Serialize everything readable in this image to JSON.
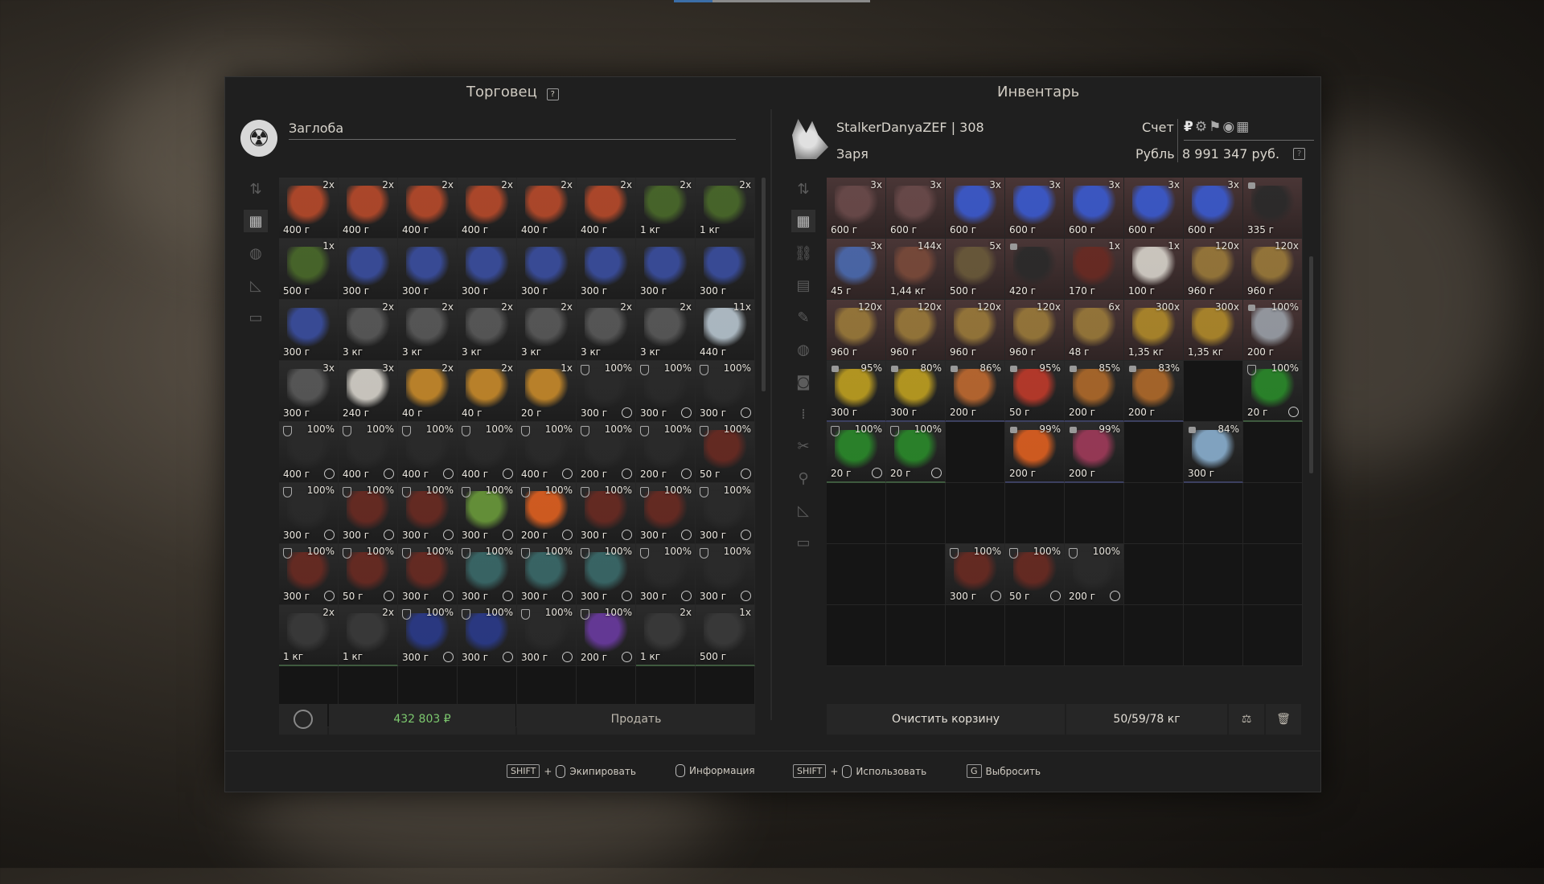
{
  "trader": {
    "title": "Торговец",
    "help": "?",
    "name": "Заглоба",
    "money": "432 803 ₽",
    "sell_label": "Продать",
    "sidebar_icons": [
      "sort-icon",
      "grid-icon",
      "grenade-icon",
      "ruler-icon",
      "box-icon"
    ],
    "slots": [
      {
        "c": "2x",
        "w": "400 г",
        "k": "cube"
      },
      {
        "c": "2x",
        "w": "400 г",
        "k": "cube"
      },
      {
        "c": "2x",
        "w": "400 г",
        "k": "cube"
      },
      {
        "c": "2x",
        "w": "400 г",
        "k": "cube"
      },
      {
        "c": "2x",
        "w": "400 г",
        "k": "cube"
      },
      {
        "c": "2x",
        "w": "400 г",
        "k": "cube"
      },
      {
        "c": "2x",
        "w": "1 кг",
        "k": "green"
      },
      {
        "c": "2x",
        "w": "1 кг",
        "k": "green"
      },
      {
        "c": "1x",
        "w": "500 г",
        "k": "green"
      },
      {
        "c": "",
        "w": "300 г",
        "k": "blue"
      },
      {
        "c": "",
        "w": "300 г",
        "k": "blue"
      },
      {
        "c": "",
        "w": "300 г",
        "k": "blue"
      },
      {
        "c": "",
        "w": "300 г",
        "k": "blue"
      },
      {
        "c": "",
        "w": "300 г",
        "k": "blue"
      },
      {
        "c": "",
        "w": "300 г",
        "k": "blue"
      },
      {
        "c": "",
        "w": "300 г",
        "k": "blue"
      },
      {
        "c": "",
        "w": "300 г",
        "k": "blue"
      },
      {
        "c": "2x",
        "w": "3 кг",
        "k": "gray"
      },
      {
        "c": "2x",
        "w": "3 кг",
        "k": "gray"
      },
      {
        "c": "2x",
        "w": "3 кг",
        "k": "gray"
      },
      {
        "c": "2x",
        "w": "3 кг",
        "k": "gray"
      },
      {
        "c": "2x",
        "w": "3 кг",
        "k": "gray"
      },
      {
        "c": "2x",
        "w": "3 кг",
        "k": "gray"
      },
      {
        "c": "11x",
        "w": "440 г",
        "k": "paper"
      },
      {
        "c": "3x",
        "w": "300 г",
        "k": "gray"
      },
      {
        "c": "3x",
        "w": "240 г",
        "k": "white"
      },
      {
        "c": "2x",
        "w": "40 г",
        "k": "orange"
      },
      {
        "c": "2x",
        "w": "40 г",
        "k": "orange"
      },
      {
        "c": "1x",
        "w": "20 г",
        "k": "orange"
      },
      {
        "c": "100%",
        "w": "300 г",
        "k": "dark",
        "a": 1
      },
      {
        "c": "100%",
        "w": "300 г",
        "k": "dark",
        "a": 1
      },
      {
        "c": "100%",
        "w": "300 г",
        "k": "dark",
        "a": 1
      },
      {
        "c": "100%",
        "w": "400 г",
        "k": "dark",
        "a": 1
      },
      {
        "c": "100%",
        "w": "400 г",
        "k": "dark",
        "a": 1
      },
      {
        "c": "100%",
        "w": "400 г",
        "k": "dark",
        "a": 1
      },
      {
        "c": "100%",
        "w": "400 г",
        "k": "dark",
        "a": 1
      },
      {
        "c": "100%",
        "w": "400 г",
        "k": "dark",
        "a": 1
      },
      {
        "c": "100%",
        "w": "200 г",
        "k": "dark",
        "a": 1
      },
      {
        "c": "100%",
        "w": "200 г",
        "k": "dark",
        "a": 1
      },
      {
        "c": "100%",
        "w": "50 г",
        "k": "rust",
        "a": 1
      },
      {
        "c": "100%",
        "w": "300 г",
        "k": "dark",
        "a": 1
      },
      {
        "c": "100%",
        "w": "300 г",
        "k": "rust",
        "a": 1
      },
      {
        "c": "100%",
        "w": "300 г",
        "k": "rust",
        "a": 1
      },
      {
        "c": "100%",
        "w": "300 г",
        "k": "lime",
        "a": 1
      },
      {
        "c": "100%",
        "w": "200 г",
        "k": "fire",
        "a": 1
      },
      {
        "c": "100%",
        "w": "300 г",
        "k": "rust",
        "a": 1
      },
      {
        "c": "100%",
        "w": "300 г",
        "k": "rust",
        "a": 1
      },
      {
        "c": "100%",
        "w": "300 г",
        "k": "dark",
        "a": 1
      },
      {
        "c": "100%",
        "w": "300 г",
        "k": "rust",
        "a": 1
      },
      {
        "c": "100%",
        "w": "50 г",
        "k": "rust",
        "a": 1
      },
      {
        "c": "100%",
        "w": "300 г",
        "k": "rust",
        "a": 1
      },
      {
        "c": "100%",
        "w": "300 г",
        "k": "teal",
        "a": 1
      },
      {
        "c": "100%",
        "w": "300 г",
        "k": "teal",
        "a": 1
      },
      {
        "c": "100%",
        "w": "300 г",
        "k": "teal",
        "a": 1
      },
      {
        "c": "100%",
        "w": "300 г",
        "k": "dark",
        "a": 1
      },
      {
        "c": "100%",
        "w": "300 г",
        "k": "dark",
        "a": 1
      },
      {
        "c": "2x",
        "w": "1 кг",
        "k": "knife",
        "g": 1
      },
      {
        "c": "2x",
        "w": "1 кг",
        "k": "knife",
        "g": 1
      },
      {
        "c": "100%",
        "w": "300 г",
        "k": "navy",
        "a": 1
      },
      {
        "c": "100%",
        "w": "300 г",
        "k": "navy",
        "a": 1
      },
      {
        "c": "100%",
        "w": "300 г",
        "k": "dark",
        "a": 1
      },
      {
        "c": "100%",
        "w": "200 г",
        "k": "spark",
        "a": 1
      },
      {
        "c": "2x",
        "w": "1 кг",
        "k": "knife",
        "g": 1
      },
      {
        "c": "1x",
        "w": "500 г",
        "k": "knife",
        "g": 1
      },
      {
        "e": 1
      },
      {
        "e": 1
      },
      {
        "e": 1
      },
      {
        "e": 1
      },
      {
        "e": 1
      },
      {
        "e": 1
      },
      {
        "e": 1
      },
      {
        "e": 1
      }
    ]
  },
  "inventory": {
    "title": "Инвентарь",
    "player": "StalkerDanyaZEF | 308",
    "faction": "Заря",
    "account_label": "Счет",
    "currency_label": "Рубль",
    "balance": "8 991 347 руб.",
    "clear_label": "Очистить корзину",
    "weight": "50/59/78 кг",
    "sidebar_icons": [
      "sort-icon",
      "grid-icon",
      "link-icon",
      "armor-icon",
      "knife-icon",
      "grenade-icon",
      "camera-icon",
      "bullets-icon",
      "tools-icon",
      "food-icon",
      "ruler-icon",
      "box-icon"
    ],
    "slots": [
      {
        "c": "3x",
        "w": "600 г",
        "k": "can",
        "r": 1
      },
      {
        "c": "3x",
        "w": "600 г",
        "k": "can",
        "r": 1
      },
      {
        "c": "3x",
        "w": "600 г",
        "k": "bluecan",
        "r": 1
      },
      {
        "c": "3x",
        "w": "600 г",
        "k": "bluecan",
        "r": 1
      },
      {
        "c": "3x",
        "w": "600 г",
        "k": "bluecan",
        "r": 1
      },
      {
        "c": "3x",
        "w": "600 г",
        "k": "bluecan",
        "r": 1
      },
      {
        "c": "3x",
        "w": "600 г",
        "k": "bluecan",
        "r": 1
      },
      {
        "c": "",
        "w": "335 г",
        "k": "dark",
        "r": 1,
        "l": 1
      },
      {
        "c": "3x",
        "w": "45 г",
        "k": "feather",
        "r": 1
      },
      {
        "c": "144x",
        "w": "1,44 кг",
        "k": "rod",
        "r": 1
      },
      {
        "c": "5x",
        "w": "500 г",
        "k": "olive",
        "r": 1
      },
      {
        "c": "",
        "w": "420 г",
        "k": "dark",
        "r": 1,
        "l": 1
      },
      {
        "c": "1x",
        "w": "170 г",
        "k": "rust",
        "r": 1
      },
      {
        "c": "1x",
        "w": "100 г",
        "k": "white",
        "r": 1
      },
      {
        "c": "120x",
        "w": "960 г",
        "k": "ammo",
        "r": 1
      },
      {
        "c": "120x",
        "w": "960 г",
        "k": "ammo",
        "r": 1
      },
      {
        "c": "120x",
        "w": "960 г",
        "k": "ammo",
        "r": 1
      },
      {
        "c": "120x",
        "w": "960 г",
        "k": "ammo",
        "r": 1
      },
      {
        "c": "120x",
        "w": "960 г",
        "k": "ammo",
        "r": 1
      },
      {
        "c": "120x",
        "w": "960 г",
        "k": "ammo",
        "r": 1
      },
      {
        "c": "6x",
        "w": "48 г",
        "k": "ammo",
        "r": 1
      },
      {
        "c": "300x",
        "w": "1,35 кг",
        "k": "shell",
        "r": 1
      },
      {
        "c": "300x",
        "w": "1,35 кг",
        "k": "shell",
        "r": 1
      },
      {
        "c": "100%",
        "w": "200 г",
        "k": "crystal",
        "r": 1,
        "l": 1
      },
      {
        "c": "95%",
        "w": "300 г",
        "k": "gold",
        "l": 1,
        "sb": 1
      },
      {
        "c": "80%",
        "w": "300 г",
        "k": "gold",
        "l": 1,
        "sb": 1
      },
      {
        "c": "86%",
        "w": "200 г",
        "k": "shell2",
        "l": 1,
        "sb": 1
      },
      {
        "c": "95%",
        "w": "50 г",
        "k": "coral",
        "l": 1,
        "sb": 1
      },
      {
        "c": "85%",
        "w": "200 г",
        "k": "berry",
        "l": 1,
        "sb": 1
      },
      {
        "c": "83%",
        "w": "200 г",
        "k": "berry",
        "l": 1,
        "sb": 1
      },
      {
        "e": 1
      },
      {
        "c": "100%",
        "w": "20 г",
        "k": "leaf",
        "a": 1,
        "sg": 1
      },
      {
        "c": "100%",
        "w": "20 г",
        "k": "leaf",
        "a": 1,
        "sg": 1
      },
      {
        "c": "100%",
        "w": "20 г",
        "k": "leaf",
        "a": 1,
        "sg": 1
      },
      {
        "e": 1
      },
      {
        "c": "99%",
        "w": "200 г",
        "k": "fire",
        "l": 1,
        "sb": 1
      },
      {
        "c": "99%",
        "w": "200 г",
        "k": "pinkcoral",
        "l": 1,
        "sb": 1
      },
      {
        "e": 1
      },
      {
        "c": "84%",
        "w": "300 г",
        "k": "ice",
        "l": 1,
        "sb": 1
      },
      {
        "e": 1
      },
      {
        "e": 1
      },
      {
        "e": 1
      },
      {
        "e": 1
      },
      {
        "e": 1
      },
      {
        "e": 1
      },
      {
        "e": 1
      },
      {
        "e": 1
      },
      {
        "e": 1
      },
      {
        "e": 1
      },
      {
        "e": 1
      },
      {
        "c": "100%",
        "w": "300 г",
        "k": "rust",
        "a": 1
      },
      {
        "c": "100%",
        "w": "50 г",
        "k": "rust",
        "a": 1
      },
      {
        "c": "100%",
        "w": "200 г",
        "k": "dark",
        "a": 1
      },
      {
        "e": 1
      },
      {
        "e": 1
      },
      {
        "e": 1
      },
      {
        "e": 1
      },
      {
        "e": 1
      },
      {
        "e": 1
      },
      {
        "e": 1
      },
      {
        "e": 1
      },
      {
        "e": 1
      },
      {
        "e": 1
      },
      {
        "e": 1
      }
    ]
  },
  "hints": [
    {
      "key": "SHIFT",
      "plus": "+",
      "label": "Экипировать"
    },
    {
      "key": "",
      "plus": "",
      "label": "Информация"
    },
    {
      "key": "SHIFT",
      "plus": "+",
      "label": "Использовать"
    },
    {
      "key": "G",
      "plus": "",
      "label": "Выбросить"
    }
  ],
  "colors": {
    "cube": "#b84a2a",
    "green": "#4a6a2a",
    "blue": "#3a4ea0",
    "gray": "#5a5a5a",
    "paper": "#b8c6d0",
    "white": "#d8d4cc",
    "orange": "#c88a2a",
    "dark": "#2a2a2a",
    "rust": "#6a2a22",
    "lime": "#6a9a3a",
    "fire": "#e06020",
    "teal": "#3a6a6a",
    "knife": "#3a3a3a",
    "navy": "#2a3a8a",
    "spark": "#6a3aa0",
    "can": "#6a4a4a",
    "bluecan": "#3a5ad0",
    "feather": "#4a6ab0",
    "rod": "#7a4a3a",
    "olive": "#6a5a3a",
    "ammo": "#9a7a3a",
    "shell": "#b08a2a",
    "crystal": "#9aa0a8",
    "gold": "#c0a020",
    "shell2": "#c06a30",
    "coral": "#c03a2a",
    "berry": "#b06a2a",
    "leaf": "#2a8a2a",
    "pinkcoral": "#a03a5a",
    "ice": "#8ab0d0",
    "money": "#6ac06a"
  }
}
